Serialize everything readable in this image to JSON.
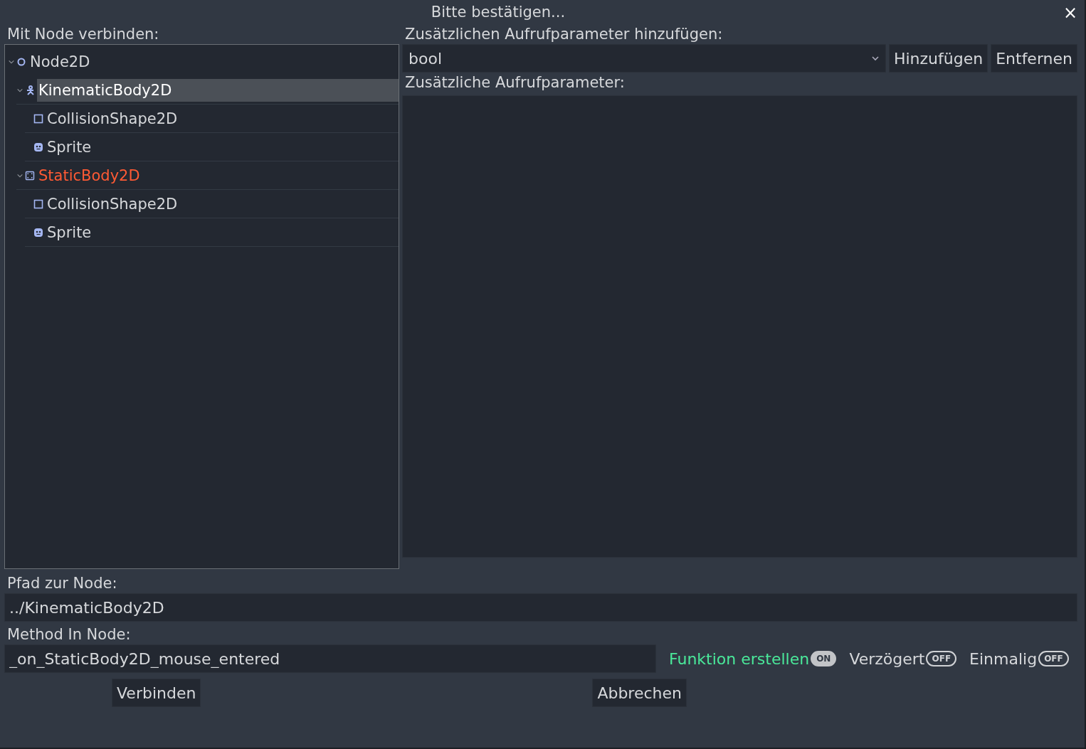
{
  "window": {
    "title": "Bitte bestätigen...",
    "close": "×"
  },
  "tree": {
    "label": "Mit Node verbinden:",
    "nodes": [
      {
        "name": "Node2D",
        "kind": "node2d",
        "expanded": true,
        "selected": false,
        "source": false,
        "children": [
          {
            "name": "KinematicBody2D",
            "kind": "kinematic",
            "expanded": true,
            "selected": true,
            "source": false,
            "children": [
              {
                "name": "CollisionShape2D",
                "kind": "collision",
                "selected": false,
                "source": false
              },
              {
                "name": "Sprite",
                "kind": "sprite",
                "selected": false,
                "source": false
              }
            ]
          },
          {
            "name": "StaticBody2D",
            "kind": "static",
            "expanded": true,
            "selected": false,
            "source": true,
            "children": [
              {
                "name": "CollisionShape2D",
                "kind": "collision",
                "selected": false,
                "source": false
              },
              {
                "name": "Sprite",
                "kind": "sprite",
                "selected": false,
                "source": false
              }
            ]
          }
        ]
      }
    ]
  },
  "params": {
    "label": "Zusätzlichen Aufrufparameter hinzufügen:",
    "type_value": "bool",
    "add_button": "Hinzufügen",
    "remove_button": "Entfernen",
    "list_label": "Zusätzliche Aufrufparameter:"
  },
  "path": {
    "label": "Pfad zur Node:",
    "value": "../KinematicBody2D"
  },
  "method": {
    "label": "Method In Node:",
    "value": "_on_StaticBody2D_mouse_entered"
  },
  "toggles": [
    {
      "label": "Funktion erstellen",
      "on": true,
      "switch_text": "ON"
    },
    {
      "label": "Verzögert",
      "on": false,
      "switch_text": "OFF"
    },
    {
      "label": "Einmalig",
      "on": false,
      "switch_text": "OFF"
    }
  ],
  "buttons": [
    "Verbinden",
    "Abbrechen"
  ]
}
